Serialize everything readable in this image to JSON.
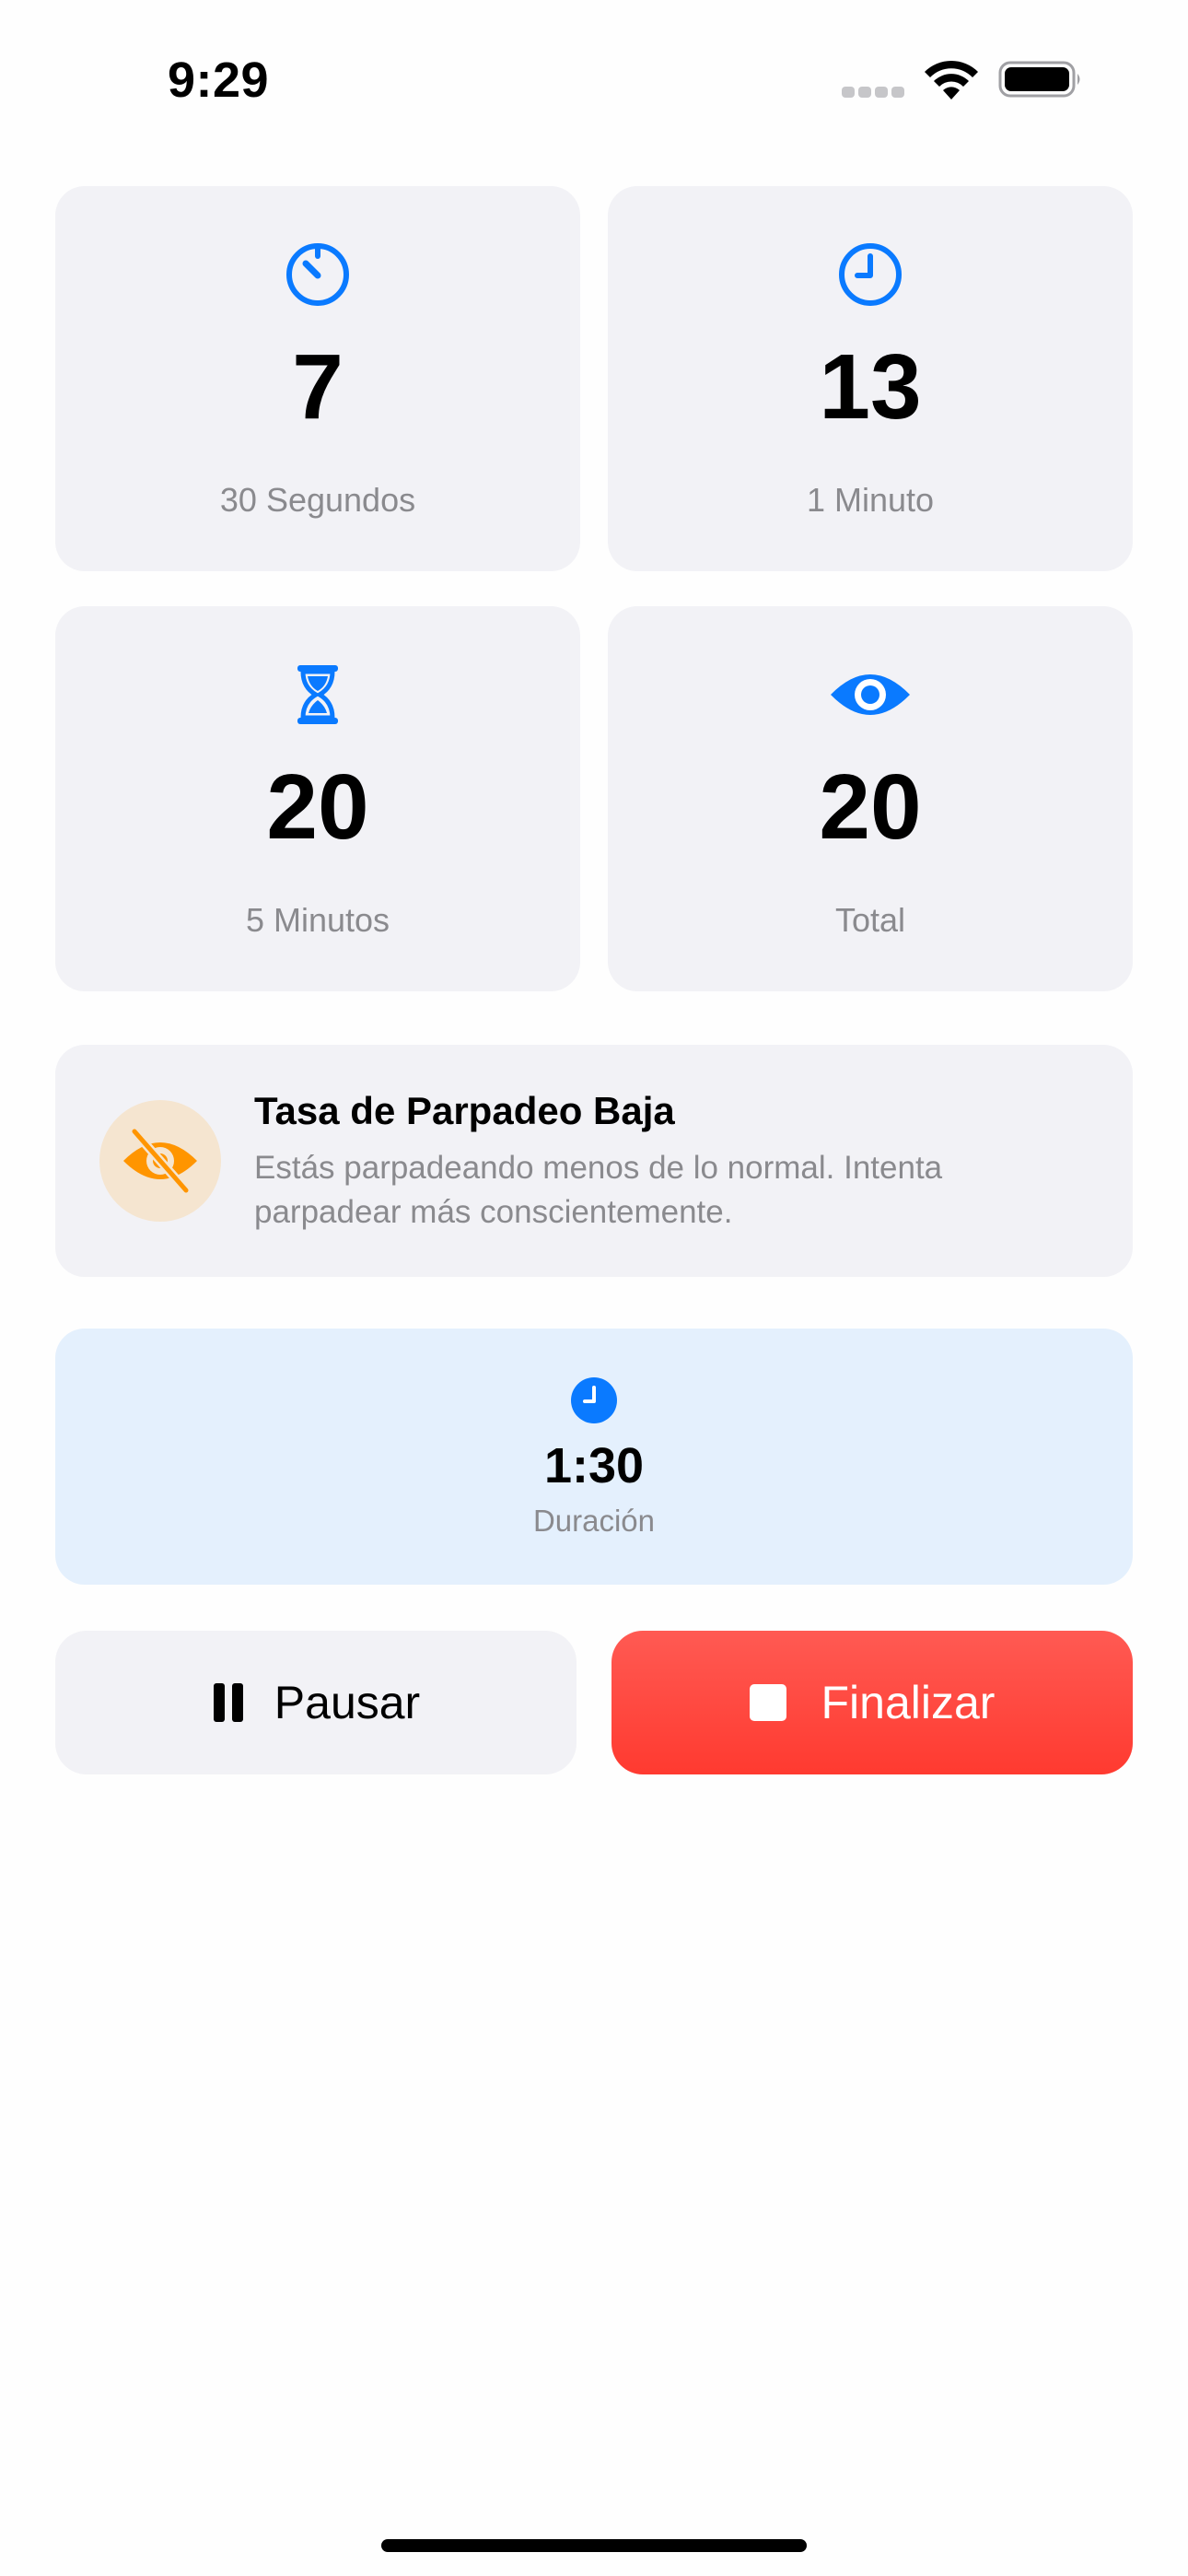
{
  "status_bar": {
    "time": "9:29"
  },
  "stats": [
    {
      "icon": "timer-icon",
      "value": "7",
      "label": "30 Segundos"
    },
    {
      "icon": "clock-icon",
      "value": "13",
      "label": "1 Minuto"
    },
    {
      "icon": "hourglass-icon",
      "value": "20",
      "label": "5 Minutos"
    },
    {
      "icon": "eye-icon",
      "value": "20",
      "label": "Total"
    }
  ],
  "alert": {
    "icon": "eye-slash-icon",
    "title": "Tasa de Parpadeo Baja",
    "message": "Estás parpadeando menos de lo normal. Intenta parpadear más conscientemente."
  },
  "duration": {
    "icon": "clock-fill-icon",
    "value": "1:30",
    "label": "Duración"
  },
  "actions": {
    "pause_label": "Pausar",
    "end_label": "Finalizar"
  },
  "colors": {
    "accent": "#0a7aff",
    "warning": "#ff9500",
    "destructive": "#ff3b30",
    "card_background": "#f2f2f6",
    "duration_background": "#e4f0fd"
  }
}
